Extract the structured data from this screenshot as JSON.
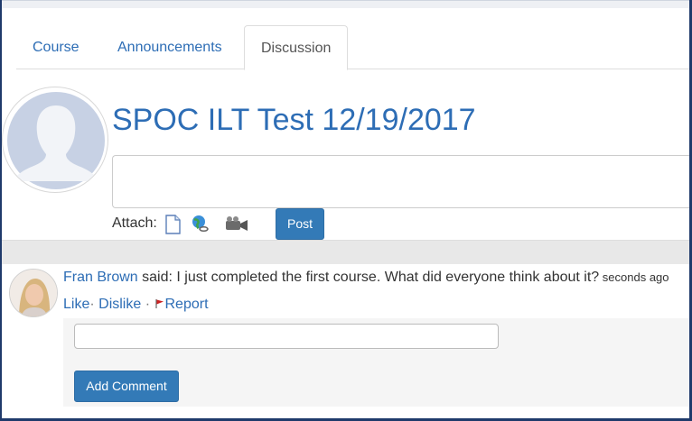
{
  "tabs": [
    {
      "label": "Course"
    },
    {
      "label": "Announcements"
    },
    {
      "label": "Discussion"
    }
  ],
  "active_tab": "Discussion",
  "group": {
    "title": "SPOC ILT Test 12/19/2017"
  },
  "composer": {
    "attach_label": "Attach:",
    "attach_icons": [
      "document-icon",
      "link-globe-icon",
      "video-camera-icon"
    ],
    "post_label": "Post"
  },
  "post": {
    "author": "Fran Brown",
    "said": " said: I just completed the first course. What did everyone think about it?",
    "timestamp": " seconds ago",
    "like_label": "Like",
    "dislike_label": "Dislike",
    "report_label": "Report"
  },
  "comment": {
    "add_label": "Add Comment"
  },
  "colors": {
    "accent": "#2d6db5",
    "button": "#337ab7",
    "flag": "#cc2222"
  }
}
